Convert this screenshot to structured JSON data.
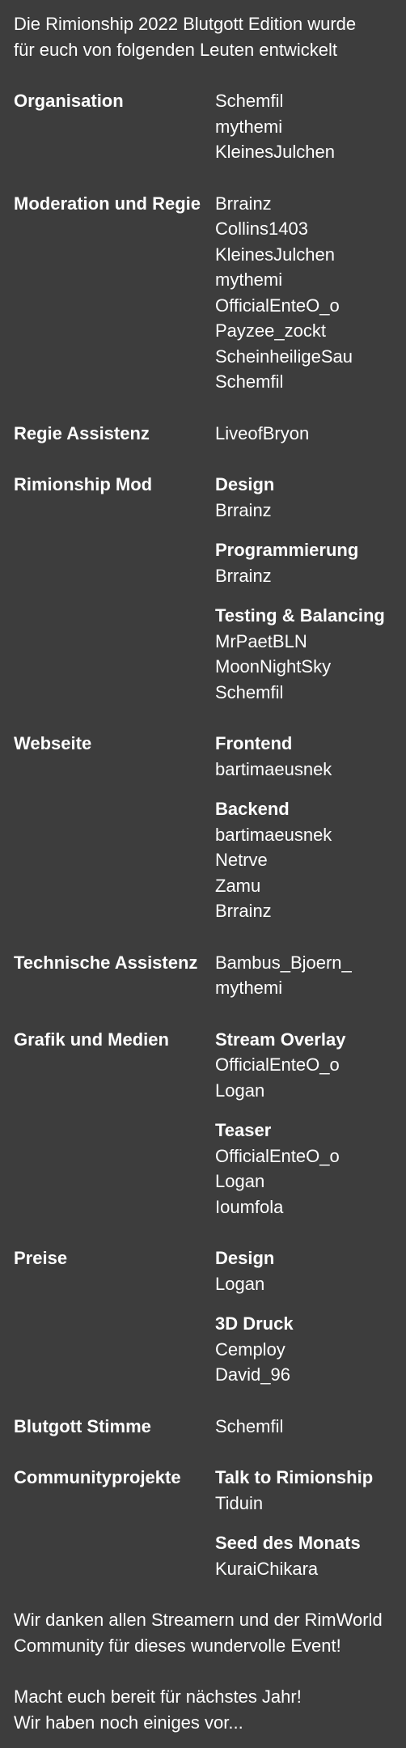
{
  "intro": {
    "line1": "Die Rimionship 2022 Blutgott Edition wurde",
    "line2": "für euch von folgenden Leuten entwickelt"
  },
  "sections": [
    {
      "label": "Organisation",
      "groups": [
        {
          "title": "",
          "names": [
            "Schemfil",
            "mythemi",
            "KleinesJulchen"
          ]
        }
      ]
    },
    {
      "label": "Moderation und Regie",
      "groups": [
        {
          "title": "",
          "names": [
            "Brrainz",
            "Collins1403",
            "KleinesJulchen",
            "mythemi",
            "OfficialEnteO_o",
            "Payzee_zockt",
            "ScheinheiligeSau",
            "Schemfil"
          ]
        }
      ]
    },
    {
      "label": "Regie Assistenz",
      "groups": [
        {
          "title": "",
          "names": [
            "LiveofBryon"
          ]
        }
      ]
    },
    {
      "label": "Rimionship Mod",
      "groups": [
        {
          "title": "Design",
          "names": [
            "Brrainz"
          ]
        },
        {
          "title": "Programmierung",
          "names": [
            "Brrainz"
          ]
        },
        {
          "title": "Testing & Balancing",
          "names": [
            "MrPaetBLN",
            "MoonNightSky",
            "Schemfil"
          ]
        }
      ]
    },
    {
      "label": "Webseite",
      "groups": [
        {
          "title": "Frontend",
          "names": [
            "bartimaeusnek"
          ]
        },
        {
          "title": "Backend",
          "names": [
            "bartimaeusnek",
            "Netrve",
            "Zamu",
            "Brrainz"
          ]
        }
      ]
    },
    {
      "label": "Technische Assistenz",
      "groups": [
        {
          "title": "",
          "names": [
            "Bambus_Bjoern_",
            "mythemi"
          ]
        }
      ]
    },
    {
      "label": "Grafik und Medien",
      "groups": [
        {
          "title": "Stream Overlay",
          "names": [
            "OfficialEnteO_o",
            "Logan"
          ]
        },
        {
          "title": "Teaser",
          "names": [
            "OfficialEnteO_o",
            "Logan",
            "Ioumfola"
          ]
        }
      ]
    },
    {
      "label": "Preise",
      "groups": [
        {
          "title": "Design",
          "names": [
            "Logan"
          ]
        },
        {
          "title": "3D Druck",
          "names": [
            "Cemploy",
            "David_96"
          ]
        }
      ]
    },
    {
      "label": "Blutgott Stimme",
      "groups": [
        {
          "title": "",
          "names": [
            "Schemfil"
          ]
        }
      ]
    },
    {
      "label": "Communityprojekte",
      "groups": [
        {
          "title": "Talk to Rimionship",
          "names": [
            "Tiduin"
          ]
        },
        {
          "title": "Seed des Monats",
          "names": [
            "KuraiChikara"
          ]
        }
      ]
    }
  ],
  "outro": {
    "thanks_line1": "Wir danken allen Streamern und der RimWorld",
    "thanks_line2": "Community für dieses wundervolle Event!",
    "next_line1": "Macht euch bereit für nächstes Jahr!",
    "next_line2": "Wir haben noch einiges vor..."
  }
}
